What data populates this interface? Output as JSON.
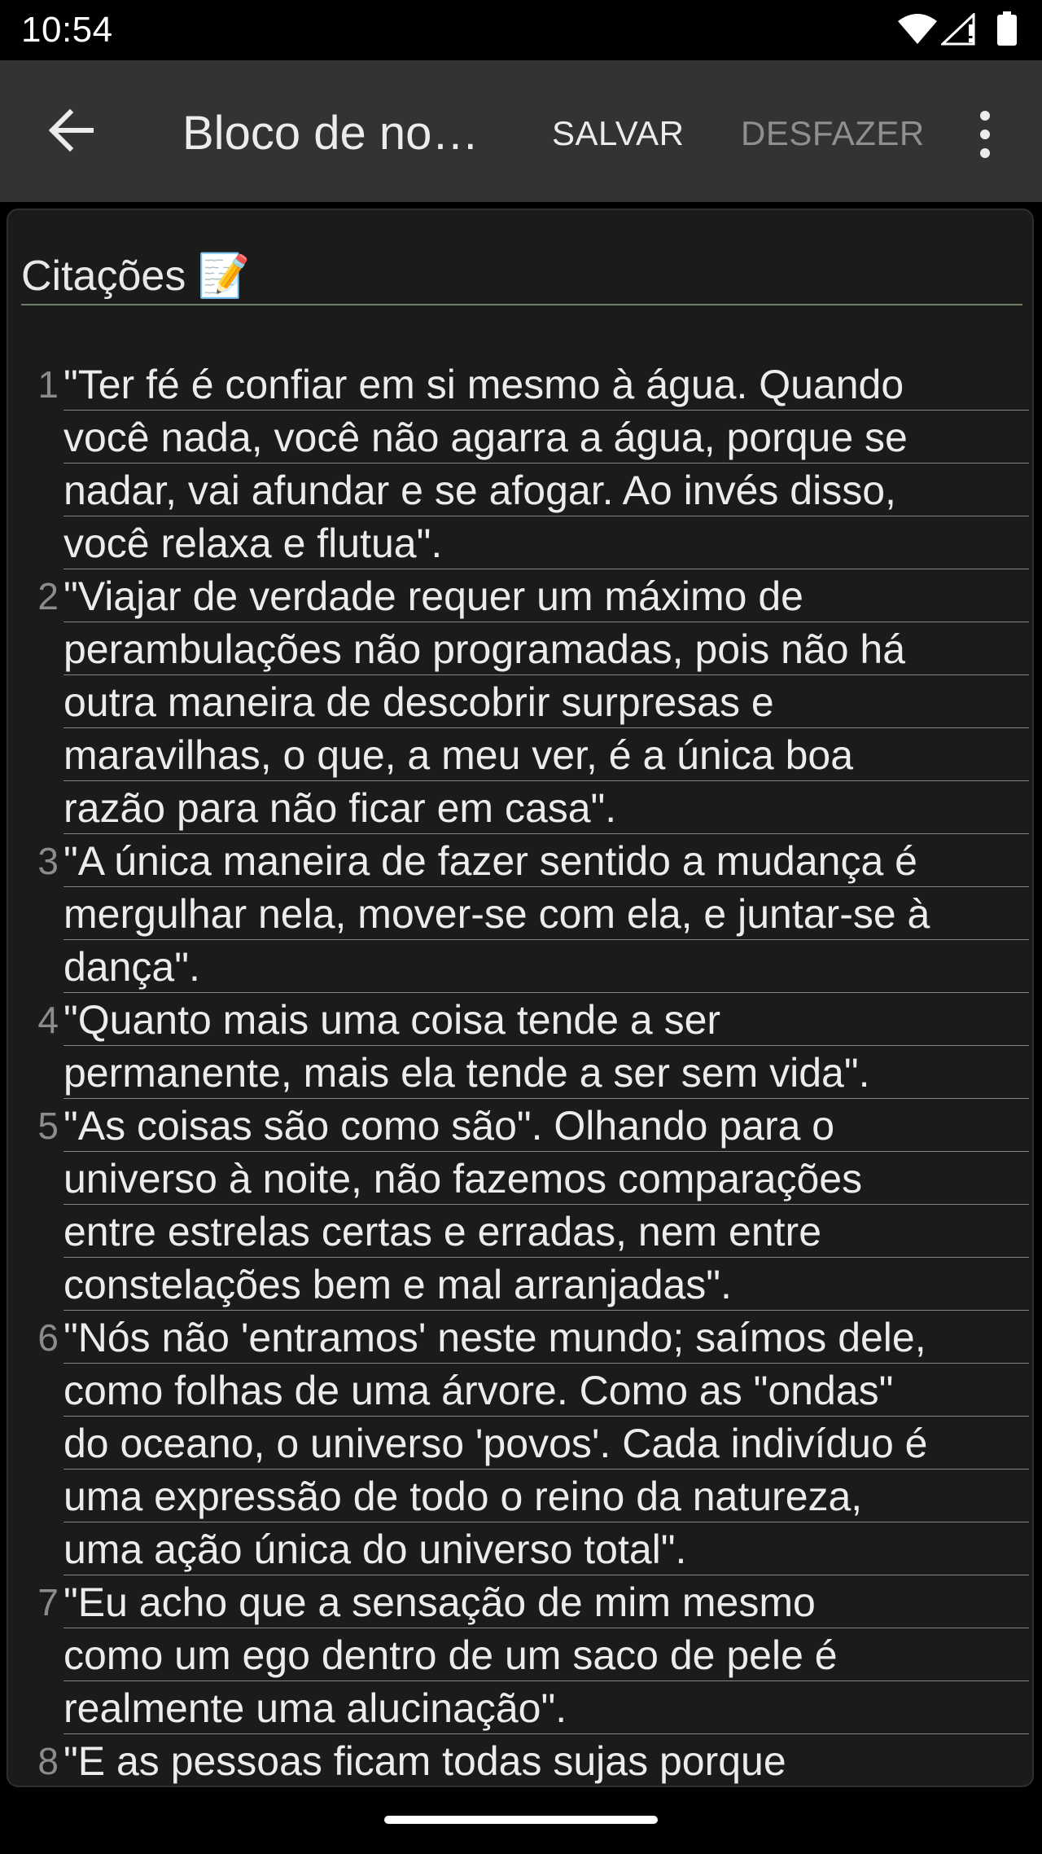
{
  "status_bar": {
    "time": "10:54",
    "icons": [
      "wifi-icon",
      "signal-icon",
      "battery-icon"
    ]
  },
  "app_bar": {
    "back_icon": "arrow-back-icon",
    "title": "Bloco de no…",
    "save_label": "SALVAR",
    "undo_label": "DESFAZER",
    "overflow_icon": "more-vert-icon"
  },
  "note": {
    "title": "Citações 📝",
    "lines": [
      {
        "num": "1",
        "text": "\"Ter fé é confiar em si mesmo à água. Quando"
      },
      {
        "num": "",
        "text": "você nada, você não agarra a água, porque se"
      },
      {
        "num": "",
        "text": "nadar, vai afundar e se afogar. Ao invés disso,"
      },
      {
        "num": "",
        "text": "você relaxa e flutua\"."
      },
      {
        "num": "2",
        "text": "\"Viajar de verdade requer um máximo de"
      },
      {
        "num": "",
        "text": "perambulações não programadas, pois não há"
      },
      {
        "num": "",
        "text": "outra maneira de descobrir surpresas e"
      },
      {
        "num": "",
        "text": "maravilhas, o que, a meu ver, é a única boa"
      },
      {
        "num": "",
        "text": "razão para não ficar em casa\"."
      },
      {
        "num": "3",
        "text": "\"A única maneira de fazer sentido a mudança é"
      },
      {
        "num": "",
        "text": "mergulhar nela, mover-se com ela, e juntar-se à"
      },
      {
        "num": "",
        "text": "dança\"."
      },
      {
        "num": "4",
        "text": "\"Quanto mais uma coisa tende a ser"
      },
      {
        "num": "",
        "text": "permanente, mais ela tende a ser sem vida\"."
      },
      {
        "num": "5",
        "text": "\"As coisas são como são\". Olhando para o"
      },
      {
        "num": "",
        "text": "universo à noite, não fazemos comparações"
      },
      {
        "num": "",
        "text": "entre estrelas certas e erradas, nem entre"
      },
      {
        "num": "",
        "text": "constelações bem e mal arranjadas\"."
      },
      {
        "num": "6",
        "text": "\"Nós não 'entramos' neste mundo; saímos dele,"
      },
      {
        "num": "",
        "text": "como folhas de uma árvore. Como as \"ondas\""
      },
      {
        "num": "",
        "text": "do oceano, o universo 'povos'. Cada indivíduo é"
      },
      {
        "num": "",
        "text": "uma expressão de todo o reino da natureza,"
      },
      {
        "num": "",
        "text": "uma ação única do universo total\"."
      },
      {
        "num": "7",
        "text": "\"Eu acho que a sensação de mim mesmo"
      },
      {
        "num": "",
        "text": "como um ego dentro de um saco de pele é"
      },
      {
        "num": "",
        "text": "realmente uma alucinação\"."
      },
      {
        "num": "8",
        "text": "\"E as pessoas ficam todas sujas porque"
      }
    ]
  },
  "nav_bar": {
    "handle": "gesture-handle"
  }
}
